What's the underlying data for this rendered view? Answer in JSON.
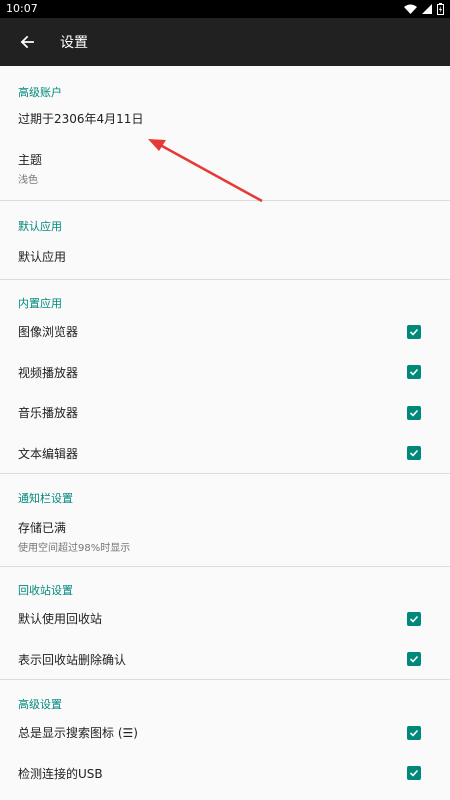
{
  "status_bar": {
    "time": "10:07"
  },
  "app_bar": {
    "title": "设置"
  },
  "premium": {
    "header": "高级账户",
    "expiry": "过期于2306年4月11日",
    "theme_title": "主题",
    "theme_value": "浅色"
  },
  "default_apps": {
    "header": "默认应用",
    "item": "默认应用"
  },
  "builtin_apps": {
    "header": "内置应用",
    "items": [
      {
        "label": "图像浏览器",
        "checked": true
      },
      {
        "label": "视频播放器",
        "checked": true
      },
      {
        "label": "音乐播放器",
        "checked": true
      },
      {
        "label": "文本编辑器",
        "checked": true
      }
    ]
  },
  "notification": {
    "header": "通知栏设置",
    "title": "存储已满",
    "subtitle": "使用空间超过98%时显示"
  },
  "recycle_bin": {
    "header": "回收站设置",
    "items": [
      {
        "label": "默认使用回收站",
        "checked": true
      },
      {
        "label": "表示回收站删除确认",
        "checked": true
      }
    ]
  },
  "advanced": {
    "header": "高级设置",
    "items": [
      {
        "label": "总是显示搜索图标 (☰)",
        "checked": true
      },
      {
        "label": "检测连接的USB",
        "checked": true
      }
    ]
  },
  "colors": {
    "accent": "#00897b",
    "toolbar": "#212121",
    "annotation_arrow": "#e53935"
  }
}
